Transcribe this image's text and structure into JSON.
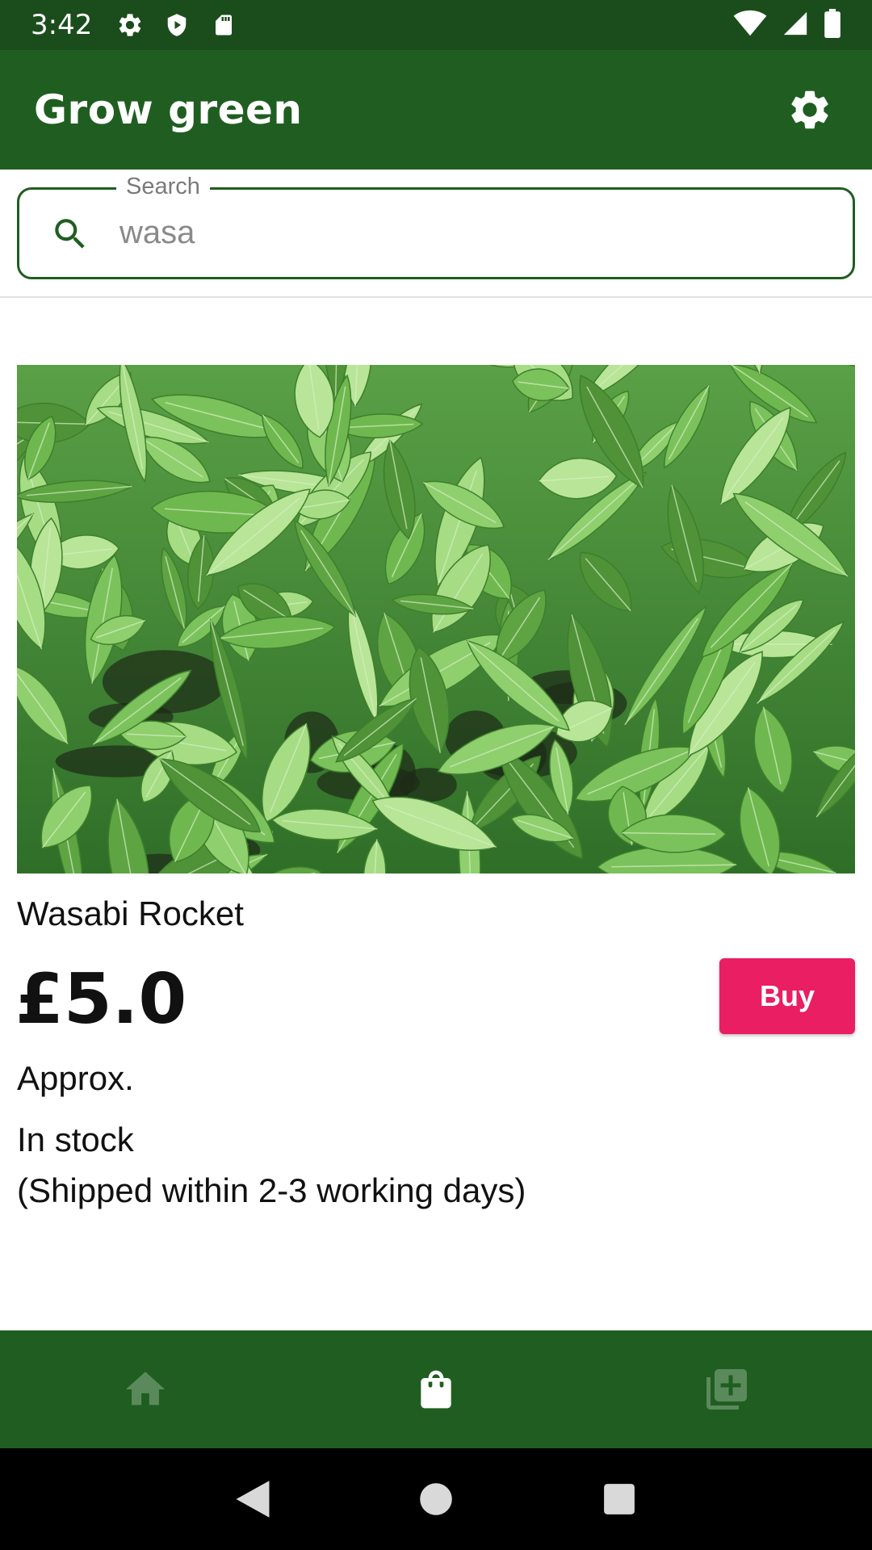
{
  "status_bar": {
    "time": "3:42",
    "left_icons": [
      "gear-icon",
      "shield-icon",
      "sd-card-icon"
    ],
    "right_icons": [
      "wifi-icon",
      "signal-icon",
      "battery-icon"
    ]
  },
  "app_bar": {
    "title": "Grow green",
    "settings_icon": "gear-icon"
  },
  "search": {
    "label": "Search",
    "value": "wasa",
    "icon": "search-icon"
  },
  "product": {
    "image_description": "rocket plant leaves",
    "name": "Wasabi Rocket",
    "price": "£5.0",
    "buy_label": "Buy",
    "price_note": "Approx.",
    "stock": "In stock",
    "shipping": "(Shipped within 2-3 working days)"
  },
  "bottom_nav": {
    "items": [
      {
        "icon": "home-icon",
        "active": false
      },
      {
        "icon": "shopping-bag-icon",
        "active": true
      },
      {
        "icon": "add-to-library-icon",
        "active": false
      }
    ]
  },
  "colors": {
    "primary_dark": "#1b4d1c",
    "primary": "#1f5e20",
    "accent": "#e91e63",
    "inactive_nav_icon": "#5a8a5b"
  }
}
